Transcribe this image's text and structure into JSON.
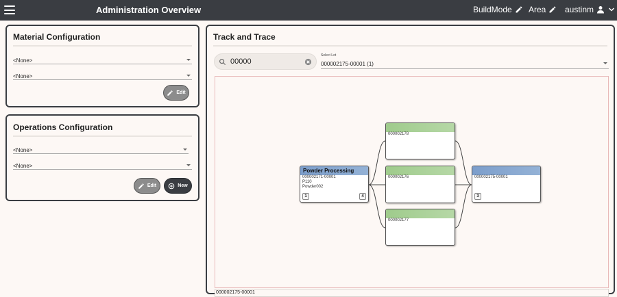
{
  "header": {
    "title": "Administration Overview",
    "buildmode_label": "BuildMode",
    "area_label": "Area",
    "user_label": "austinm"
  },
  "material_config": {
    "title": "Material Configuration",
    "select1": "<None>",
    "select2": "<None>",
    "edit_label": "Edit"
  },
  "operations_config": {
    "title": "Operations Configuration",
    "select1": "<None>",
    "select2": "<None>",
    "edit_label": "Edit",
    "new_label": "New"
  },
  "track_trace": {
    "title": "Track and Trace",
    "search_value": "00000",
    "lot_label": "Select Lot",
    "lot_value": "000002175-00001 (1)",
    "status_text": "000002175-00001",
    "nodes": {
      "source": {
        "title": "Powder Processing",
        "lines": [
          "000002171-00001",
          "P110",
          "Powder002"
        ],
        "badge_left": "1",
        "badge_right": "4"
      },
      "mid_top": {
        "lot": "000002178"
      },
      "mid_center": {
        "lot": "000002176"
      },
      "mid_bottom": {
        "lot": "000002177"
      },
      "target": {
        "lot": "000002175-00001",
        "badge": "3"
      }
    }
  },
  "colors": {
    "topbar": "#3a3d42",
    "node_blue": "#7c9ecb",
    "node_green": "#9fcb8c"
  }
}
